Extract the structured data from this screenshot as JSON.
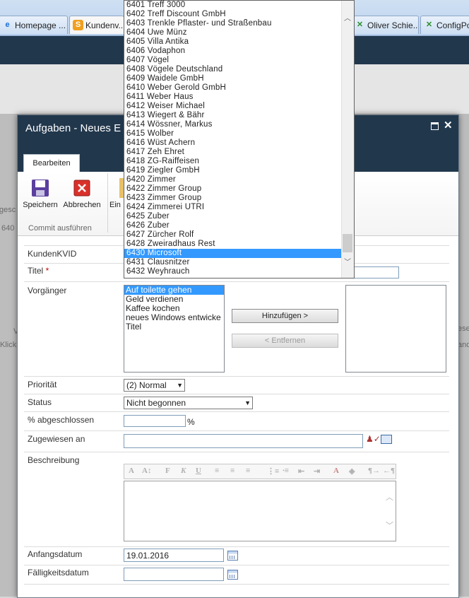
{
  "browser": {
    "tabs": [
      {
        "label": "Homepage ...",
        "active": false
      },
      {
        "label": "Kundenv...",
        "active": true
      },
      {
        "label": "Oliver Schie...",
        "active": false
      },
      {
        "label": "ConfigPo",
        "active": false
      }
    ]
  },
  "background": {
    "frag1": "gesc",
    "frag2": "640",
    "frag3": "Klick",
    "frag4": "V",
    "frag5": "ese",
    "frag6": "and"
  },
  "dialog": {
    "title": "Aufgaben - Neues E",
    "ribbon": {
      "tab": "Bearbeiten",
      "save": "Speichern",
      "cancel": "Abbrechen",
      "paste": "Ein",
      "group_label": "Commit ausführen"
    },
    "form": {
      "kundenkvid_label": "KundenKVID",
      "titel_label": "Titel",
      "required_mark": "*",
      "vorgaenger_label": "Vorgänger",
      "vorgaenger_items": [
        "Auf toilette gehen",
        "Geld verdienen",
        "Kaffee kochen",
        "neues Windows entwicke",
        "Titel"
      ],
      "add_button": "Hinzufügen >",
      "remove_button": "< Entfernen",
      "prioritaet_label": "Priorität",
      "prioritaet_value": "(2) Normal",
      "status_label": "Status",
      "status_value": "Nicht begonnen",
      "abgeschlossen_label": "% abgeschlossen",
      "percent_sign": "%",
      "zugewiesen_label": "Zugewiesen an",
      "beschreibung_label": "Beschreibung",
      "anfangsdatum_label": "Anfangsdatum",
      "anfangsdatum_value": "19.01.2016",
      "faelligkeitsdatum_label": "Fälligkeitsdatum"
    }
  },
  "dropdown": {
    "items": [
      "6401 Treff 3000",
      "6402 Treff Discount GmbH",
      "6403 Trenkle Pflaster- und Straßenbau",
      "6404 Uwe Münz",
      "6405 Villa Antika",
      "6406 Vodaphon",
      "6407 Vögel",
      "6408 Vögele Deutschland",
      "6409 Waidele GmbH",
      "6410 Weber Gerold GmbH",
      "6411 Weber Haus",
      "6412 Weiser Michael",
      "6413 Wiegert & Bähr",
      "6414 Wössner, Markus",
      "6415 Wolber",
      "6416 Wüst Achern",
      "6417 Zeh Ehret",
      "6418 ZG-Raiffeisen",
      "6419 Ziegler GmbH",
      "6420 Zimmer",
      "6422 Zimmer Group",
      "6423 Zimmer Group",
      "6424 Zimmerei UTRI",
      "6425 Zuber",
      "6426 Zuber",
      "6427 Zürcher Rolf",
      "6428 Zweiradhaus Rest",
      "6430 Microsoft",
      "6431 Clausnitzer",
      "6432 Weyhrauch"
    ],
    "selected_index": 27
  },
  "colors": {
    "accent": "#21374c",
    "selection": "#3399ff",
    "required": "#cc0000"
  }
}
